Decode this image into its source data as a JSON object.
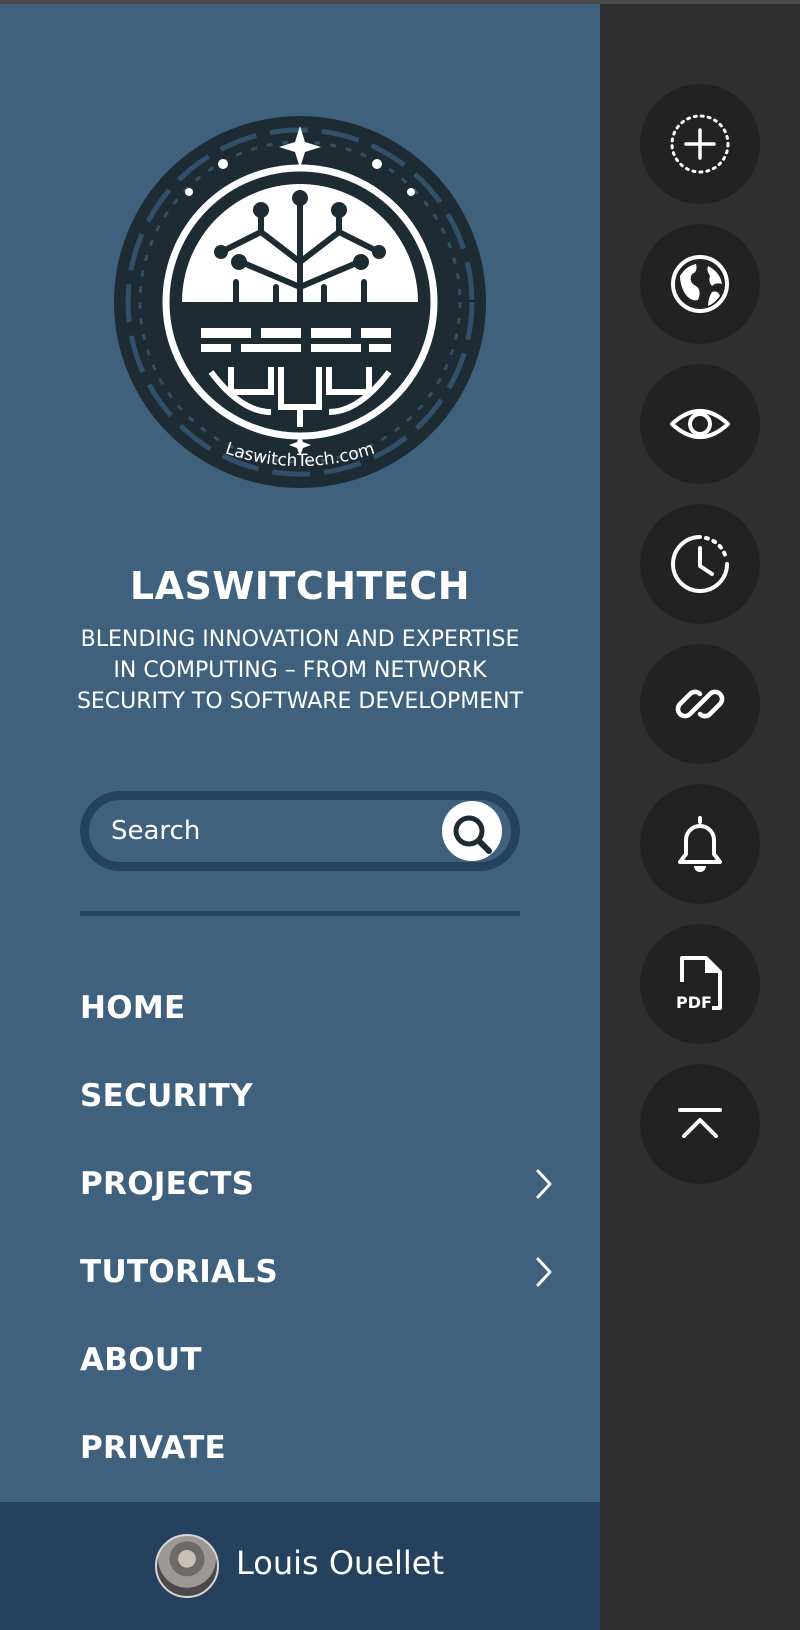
{
  "brand": {
    "title": "LASWITCHTECH",
    "tagline": "BLENDING INNOVATION AND EXPERTISE IN COMPUTING – FROM NETWORK SECURITY TO SOFTWARE DEVELOPMENT",
    "logo_text": "LaswitchTech.com"
  },
  "search": {
    "placeholder": "Search",
    "button_icon": "search-icon"
  },
  "nav": {
    "items": [
      {
        "label": "HOME",
        "has_submenu": false
      },
      {
        "label": "SECURITY",
        "has_submenu": false
      },
      {
        "label": "PROJECTS",
        "has_submenu": true
      },
      {
        "label": "TUTORIALS",
        "has_submenu": true
      },
      {
        "label": "ABOUT",
        "has_submenu": false
      },
      {
        "label": "PRIVATE",
        "has_submenu": false
      }
    ]
  },
  "user": {
    "name": "Louis Ouellet"
  },
  "rail": {
    "buttons": [
      {
        "icon": "add-dotted-circle-icon"
      },
      {
        "icon": "globe-icon"
      },
      {
        "icon": "eye-icon"
      },
      {
        "icon": "clock-history-icon"
      },
      {
        "icon": "link-icon"
      },
      {
        "icon": "bell-icon"
      },
      {
        "icon": "pdf-file-icon",
        "text": "PDF"
      },
      {
        "icon": "scroll-to-top-icon"
      }
    ]
  },
  "colors": {
    "sidebar": "#40617d",
    "sidebar_dark": "#26415e",
    "rail_background": "#2f2f2f",
    "rail_button": "#222222",
    "text": "#ffffff"
  }
}
